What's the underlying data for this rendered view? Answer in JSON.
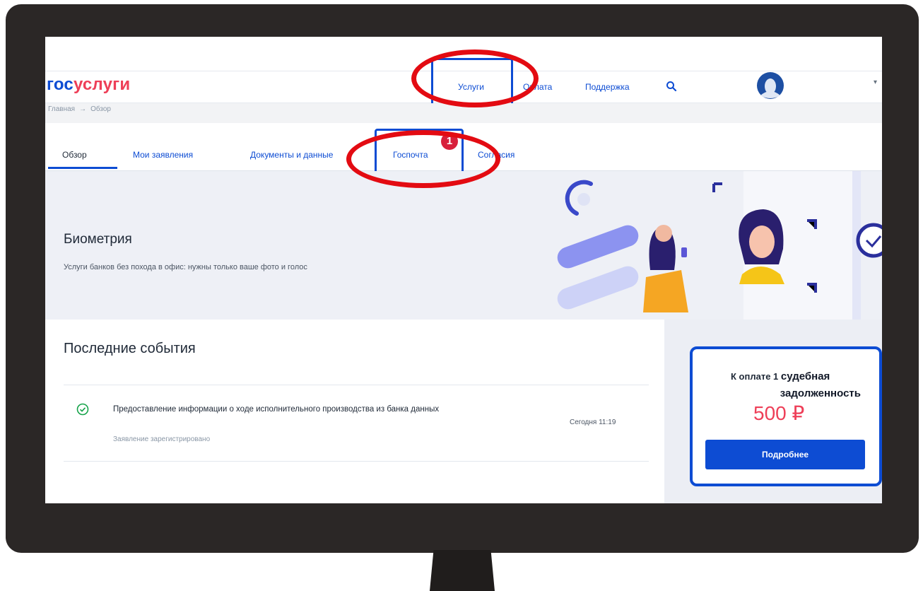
{
  "brand": {
    "part1": "гос",
    "part2": "услуги"
  },
  "nav": {
    "services": "Услуги",
    "pay": "Оплата",
    "support": "Поддержка"
  },
  "breadcrumb": {
    "home": "Главная",
    "arrow": "→",
    "current": "Обзор"
  },
  "tabs": {
    "overview": "Обзор",
    "applications": "Мои заявления",
    "documents": "Документы и данные",
    "mail": "Госпочта",
    "mail_badge": "1",
    "consents": "Согласия"
  },
  "banner": {
    "title": "Биометрия",
    "subtitle": "Услуги банков без похода в офис: нужны только ваше фото и голос"
  },
  "events": {
    "title": "Последние события",
    "items": [
      {
        "title": "Предоставление информации о ходе исполнительного производства из банка данных",
        "status": "Заявление зарегистрировано",
        "time": "Сегодня 11:19"
      }
    ]
  },
  "payment": {
    "line1_prefix": "К оплате 1",
    "line1_big": "судебная",
    "line2": "задолженность",
    "amount": "500 ₽",
    "button": "Подробнее"
  },
  "colors": {
    "brand_blue": "#0d4cd3",
    "brand_red": "#ee3f58",
    "highlight_ring": "#e30b12",
    "badge_red": "#d8203b"
  }
}
